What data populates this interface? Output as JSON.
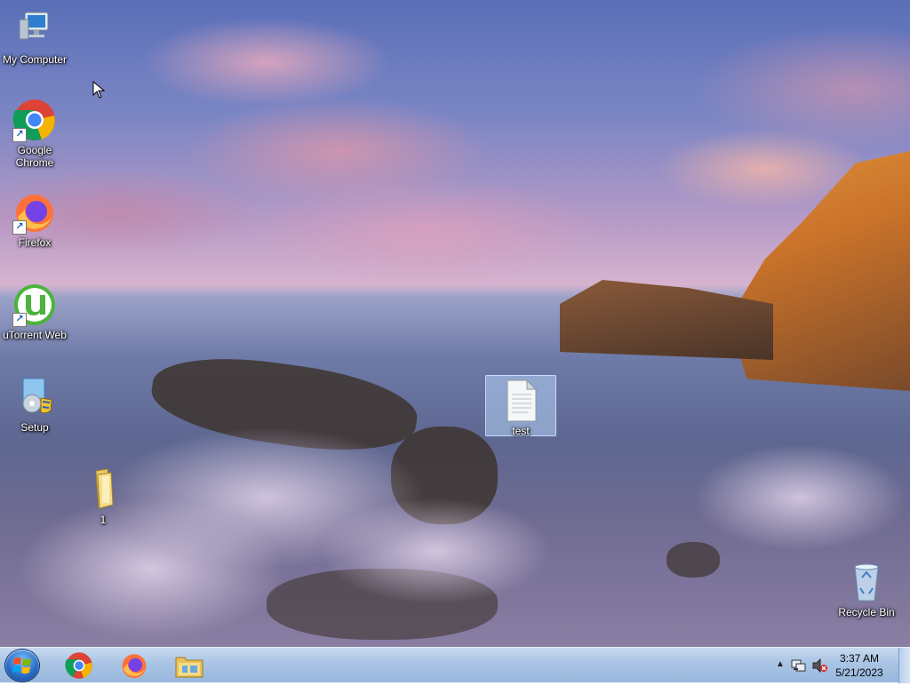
{
  "desktop": {
    "icons": [
      {
        "label": "My Computer",
        "icon": "computer-icon"
      },
      {
        "label": "Google Chrome",
        "icon": "chrome-icon"
      },
      {
        "label": "Firefox",
        "icon": "firefox-icon"
      },
      {
        "label": "uTorrent Web",
        "icon": "utorrent-icon"
      },
      {
        "label": "Setup",
        "icon": "setup-icon"
      },
      {
        "label": "1",
        "icon": "folder-icon"
      },
      {
        "label": "test",
        "icon": "text-file-icon"
      },
      {
        "label": "Recycle Bin",
        "icon": "recycle-bin-icon"
      }
    ]
  },
  "taskbar": {
    "pinned": [
      {
        "icon": "start-orb-icon"
      },
      {
        "icon": "chrome-icon"
      },
      {
        "icon": "firefox-icon"
      },
      {
        "icon": "file-explorer-icon"
      }
    ],
    "tray": {
      "icons": [
        "show-hidden-icons-chevron",
        "network-icon",
        "volume-muted-icon"
      ],
      "time": "3:37 AM",
      "date": "5/21/2023"
    }
  },
  "colors": {
    "taskbar": "#a9c4e4",
    "selection": "#b4d2f5"
  }
}
